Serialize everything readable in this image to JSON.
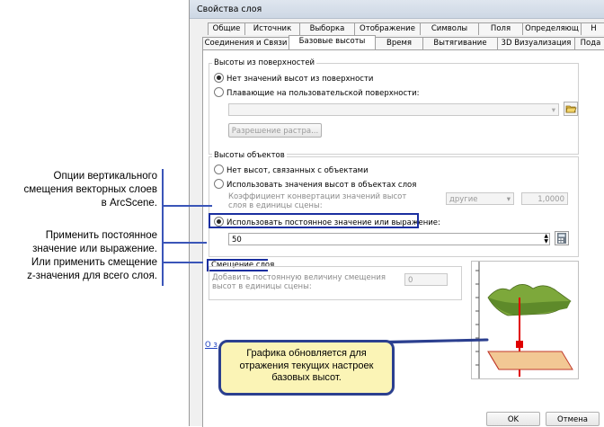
{
  "annotations": {
    "vertical_offset": [
      "Опции вертикального",
      "смещения векторных слоев",
      "в ArcScene."
    ],
    "constant_value": [
      "Применить постоянное",
      "значение или выражение.",
      "Или применить смещение",
      "z-значения для всего слоя."
    ]
  },
  "dialog": {
    "title": "Свойства слоя",
    "tabs_row1": [
      "Общие",
      "Источник",
      "Выборка",
      "Отображение",
      "Символы",
      "Поля",
      "Определяющ",
      "Н"
    ],
    "tabs_row2": [
      "Соединения и Связи",
      "Базовые высоты",
      "Время",
      "Вытягивание",
      "3D Визуализация",
      "Пода"
    ],
    "surface": {
      "legend": "Высоты из поверхностей",
      "opt_none": "Нет значений высот из поверхности",
      "opt_floating": "Плавающие на пользовательской поверхности:",
      "surface_value": "",
      "resolution_button": "Разрешение растра..."
    },
    "features": {
      "legend": "Высоты объектов",
      "opt_none": "Нет высот, связанных с объектами",
      "opt_values": "Использовать значения высот в объектах слоя",
      "conversion_label": "Коэффициент конвертации значений высот слоя в единицы сцены:",
      "units_select": "другие",
      "factor": "1,0000",
      "opt_constant": "Использовать постоянное значение или выражение:",
      "constant_value": "50"
    },
    "offset": {
      "legend": "Смещение слоя",
      "label": "Добавить постоянную величину смещения высот в единицы сцены:",
      "value": "0"
    },
    "link_text": "О з",
    "ok_button": "OK",
    "cancel_button": "Отмена"
  },
  "callout_text": [
    "Графика обновляется для",
    "отражения текущих настроек",
    "базовых высот."
  ],
  "colors": {
    "callout_border": "#2b3f8f",
    "callout_fill": "#fbf4b6",
    "highlight": "#1a2fa0",
    "accent_red": "#e00000"
  }
}
